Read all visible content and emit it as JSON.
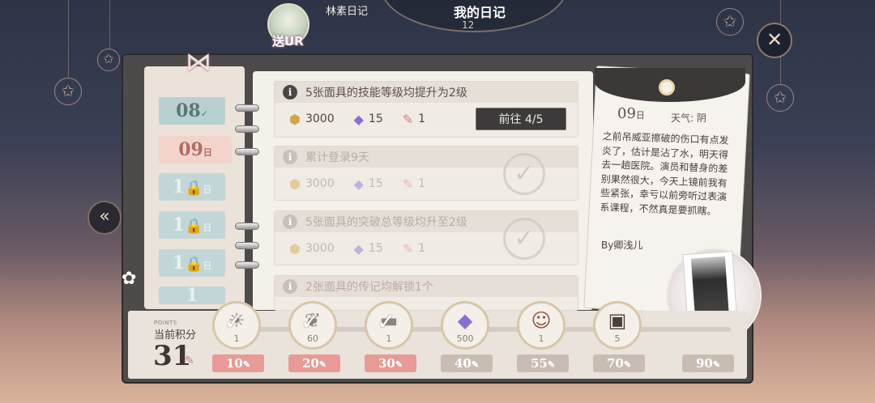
{
  "header": {
    "avatar_label": "送UR",
    "tab_diary": "林素日记",
    "title": "我的日记",
    "clock_number": "12"
  },
  "icons": {
    "close": "close-icon",
    "prev": "double-chevron-left-icon",
    "lock": "lock-icon",
    "info": "info-icon",
    "coin": "coin-icon",
    "gem": "crystal-icon",
    "pen": "pen-icon",
    "check": "checkmark-stamp-icon"
  },
  "date_tabs": [
    {
      "day": "08",
      "mark": "✓",
      "state": "done"
    },
    {
      "day": "09",
      "mark": "日",
      "state": "active"
    },
    {
      "day": "1",
      "mark": "日",
      "state": "locked"
    },
    {
      "day": "1",
      "mark": "日",
      "state": "locked"
    },
    {
      "day": "1",
      "mark": "日",
      "state": "locked"
    },
    {
      "day": "1",
      "mark": "",
      "state": "locked"
    }
  ],
  "tasks": [
    {
      "title": "5张面具的技能等级均提升为2级",
      "coin": "3000",
      "gem": "15",
      "pen": "1",
      "button": "前往 4/5",
      "state": "active"
    },
    {
      "title": "累计登录9天",
      "coin": "3000",
      "gem": "15",
      "pen": "1",
      "state": "completed"
    },
    {
      "title": "5张面具的突破总等级均升至2级",
      "coin": "3000",
      "gem": "15",
      "pen": "1",
      "state": "completed"
    },
    {
      "title": "2张面具的传记均解锁1个",
      "state": "completed"
    }
  ],
  "diary_note": {
    "day": "09",
    "day_suffix": "日",
    "weather": "天气: 阴",
    "body": "之前吊威亚擦破的伤口有点发炎了，估计是沾了水，明天得去一趟医院。演员和替身的差别果然很大，今天上镜前我有些紧张，幸亏以前旁听过表演系课程，不然真是要抓瞎。",
    "signature": "By卿浅儿"
  },
  "points": {
    "small_label": "POINTS",
    "label": "当前积分",
    "value": "31"
  },
  "milestones": [
    {
      "count": "1",
      "cost": "10",
      "claimed": true,
      "style": "red"
    },
    {
      "count": "60",
      "cost": "20",
      "claimed": true,
      "style": "red"
    },
    {
      "count": "1",
      "cost": "30",
      "claimed": true,
      "style": "red"
    },
    {
      "count": "500",
      "cost": "40",
      "claimed": false,
      "style": "gray"
    },
    {
      "count": "1",
      "cost": "55",
      "claimed": false,
      "style": "gray"
    },
    {
      "count": "5",
      "cost": "70",
      "claimed": false,
      "style": "gray"
    },
    {
      "count": "",
      "cost": "90",
      "claimed": false,
      "style": "gray"
    }
  ],
  "colors": {
    "accent_red": "#e89a95",
    "tab_done": "#b8d0d0",
    "tab_active": "#f2d4cc",
    "button_dark": "#3c3a3a"
  }
}
